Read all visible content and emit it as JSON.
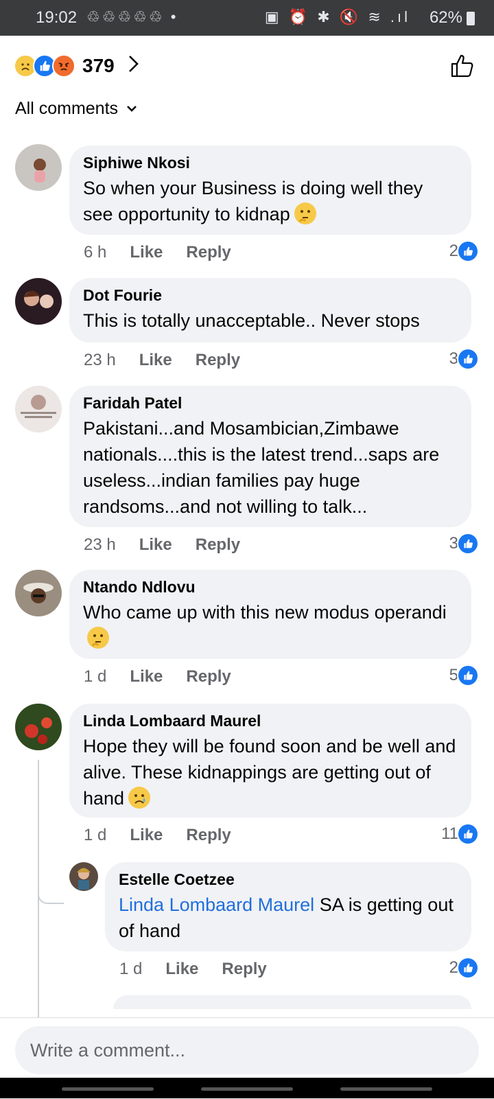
{
  "status_bar": {
    "time": "19:02",
    "notification_icons": "♲♲♲♲♲ •",
    "system_icons": "▣ ⏰ ✱ 🔇 ≋ .ıl",
    "battery": "62%"
  },
  "header": {
    "reaction_icons": [
      "sad-face",
      "like",
      "angry-face"
    ],
    "reactions_count": "379",
    "sort_label": "All comments"
  },
  "comments": [
    {
      "author": "Siphiwe Nkosi",
      "text": "So when your Business is doing well they see opportunity to kidnap",
      "emoji": "thinking-face",
      "time": "6 h",
      "like_label": "Like",
      "reply_label": "Reply",
      "likes": "2"
    },
    {
      "author": "Dot Fourie",
      "text": "This is totally unacceptable.. Never stops",
      "time": "23 h",
      "like_label": "Like",
      "reply_label": "Reply",
      "likes": "3"
    },
    {
      "author": "Faridah Patel",
      "text": "Pakistani...and Mosambician,Zimbawe nationals....this is the latest trend...saps are useless...indian families pay huge randsoms...and not willing to talk...",
      "time": "23 h",
      "like_label": "Like",
      "reply_label": "Reply",
      "likes": "3"
    },
    {
      "author": "Ntando Ndlovu",
      "text": "Who came up with this new modus operandi",
      "emoji": "thinking-face",
      "time": "1 d",
      "like_label": "Like",
      "reply_label": "Reply",
      "likes": "5"
    },
    {
      "author": "Linda Lombaard Maurel",
      "text": "Hope they will be found soon and be well and alive. These kidnappings are getting out of hand",
      "emoji": "crying-face",
      "time": "1 d",
      "like_label": "Like",
      "reply_label": "Reply",
      "likes": "11"
    }
  ],
  "reply": {
    "author": "Estelle Coetzee",
    "mention": "Linda Lombaard Maurel",
    "text": "SA is getting out of hand",
    "time": "1 d",
    "like_label": "Like",
    "reply_label": "Reply",
    "likes": "2"
  },
  "composer": {
    "placeholder": "Write a comment..."
  },
  "colors": {
    "accent": "#1877f2",
    "bubble": "#f0f2f5",
    "mention": "#216fdb",
    "status_bar": "#3a3b3c"
  }
}
